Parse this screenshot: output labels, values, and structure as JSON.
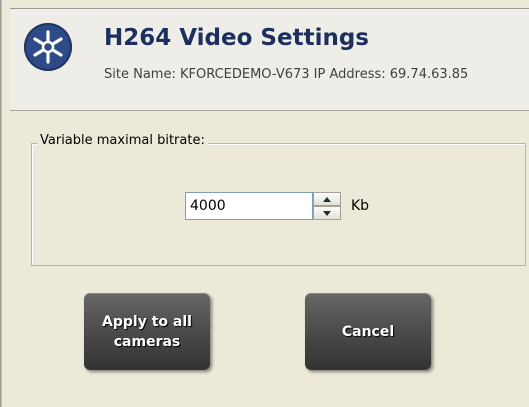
{
  "header": {
    "title": "H264 Video Settings",
    "site_info": "Site Name: KFORCEDEMO-V673   IP Address: 69.74.63.85",
    "logo_icon": "network-star-icon"
  },
  "bitrate_group": {
    "label": "Variable maximal bitrate:",
    "value": "4000",
    "unit": "Kb"
  },
  "buttons": {
    "apply_all": "Apply to all cameras",
    "cancel": "Cancel"
  },
  "colors": {
    "title": "#1c2f5e",
    "logo": "#2e4a87",
    "button": "#4b4b4b"
  }
}
